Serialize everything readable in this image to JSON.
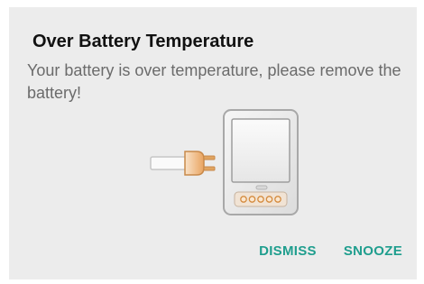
{
  "dialog": {
    "title": "Over Battery Temperature",
    "message": "Your battery is over temperature, please remove the battery!",
    "illustration_icon": "battery-removal-icon",
    "actions": {
      "dismiss_label": "DISMISS",
      "snooze_label": "SNOOZE"
    },
    "accent_color": "#1f9e8e"
  }
}
